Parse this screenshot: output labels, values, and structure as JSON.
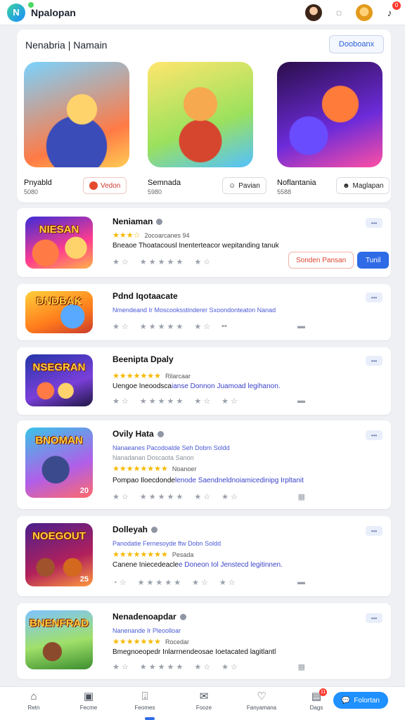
{
  "header": {
    "app_title": "Npalopan",
    "logo_letter": "N"
  },
  "featured": {
    "title": "Nenabria | Namain",
    "action_label": "Dooboanx",
    "items": [
      {
        "name": "Pnyabld",
        "sub": "5080",
        "button": "Vedon",
        "thumb_text": ""
      },
      {
        "name": "Semnada",
        "sub": "5980",
        "button": "Pavian",
        "thumb_text": ""
      },
      {
        "name": "Noflantania",
        "sub": "5588",
        "button": "Maglapan",
        "thumb_text": ""
      }
    ]
  },
  "apps": [
    {
      "name": "Neniaman",
      "thumb_text": "NIESAN",
      "rating_text": "2ocoarcanes 94",
      "desc_plain": "Bneaoe Thoatacousl Inenterteacor wepitanding tanuk",
      "desc_hl": "",
      "stats": [
        "★ ☆",
        "★ ★ ★ ★ ★",
        "★ ☆"
      ],
      "actions": [
        "Sonden Pansan",
        "Tunil"
      ]
    },
    {
      "name": "Pdnd Iqotaacate",
      "thumb_text": "DNDBAK",
      "line1": "Nmendeand Ir Moscooksstinderer Sxoondonteaton Nanad",
      "stats": [
        "★ ☆",
        "★ ★ ★ ★ ★",
        "★ ☆",
        "▪▪"
      ],
      "end": "▬"
    },
    {
      "name": "Beenipta Dpaly",
      "thumb_text": "NSEGRAN",
      "rating_text": "Rilarcaar",
      "desc_plain": "Uengoe Ineoodsca",
      "desc_hl": "ianse Donnon Juamoad legihanon.",
      "stats": [
        "★ ☆",
        "★ ★ ★ ★ ★",
        "★ ☆",
        "★ ☆"
      ],
      "end": "▬"
    },
    {
      "name": "Ovily Hata",
      "thumb_text": "BNOMAN",
      "thumb_corner": "20",
      "line1": "Nanaeanes Pacodoalde Seh Dobm Soldd",
      "line2": "Nanadanan Doscaota Sanon",
      "rating_text": "Noanoer",
      "desc_plain": "Pompao Iloecdonde",
      "desc_hl": "lenode Saendneldnoiamicedinipg Irpltanit",
      "stats": [
        "★ ☆",
        "★ ★ ★ ★ ★",
        "★ ☆",
        "★ ☆"
      ],
      "end": "▦"
    },
    {
      "name": "Dolleyah",
      "thumb_text": "NOEGOUT",
      "thumb_corner": "25",
      "line1": "Panodatie Fernesoyde ftw Dobn Soldd",
      "rating_text": "Pesada",
      "desc_plain": "Canene Iniecedeacle",
      "desc_hl": "e Doneon Iol Jenstecd legitinnen.",
      "stats": [
        "◔ ☆",
        "★ ★ ★ ★ ★",
        "★ ☆",
        "★ ☆"
      ],
      "end": "▬"
    },
    {
      "name": "Nenadenoapdar",
      "thumb_text": "BNENFRAD",
      "line1": "Nanenande Ir Pleoolloar",
      "rating_text": "Rocedar",
      "desc_plain": "Bmegnoeopedr Inlarrnendeosae Ioetacated lagit",
      "desc_hl": "",
      "desc_end": "lantl",
      "stats": [
        "★ ☆",
        "★ ★ ★ ★ ★",
        "★ ☆",
        "★ ☆"
      ],
      "end": "▦"
    }
  ],
  "more_label": "•••",
  "nav": [
    {
      "label": "Retn",
      "icon": "home-icon",
      "glyph": "⌂"
    },
    {
      "label": "Fecme",
      "icon": "store-icon",
      "glyph": "▣"
    },
    {
      "label": "Feomes",
      "icon": "download-icon",
      "glyph": "⍗"
    },
    {
      "label": "Fooze",
      "icon": "mail-icon",
      "glyph": "✉"
    },
    {
      "label": "Fanyamana",
      "icon": "heart-icon",
      "glyph": "♡"
    },
    {
      "label": "Dags",
      "icon": "bag-icon",
      "glyph": "▤",
      "badge": "11"
    }
  ],
  "chat_label": "Folortan",
  "colors": {
    "accent": "#2f6be6",
    "star": "#f6b800",
    "danger": "#d9442e"
  }
}
